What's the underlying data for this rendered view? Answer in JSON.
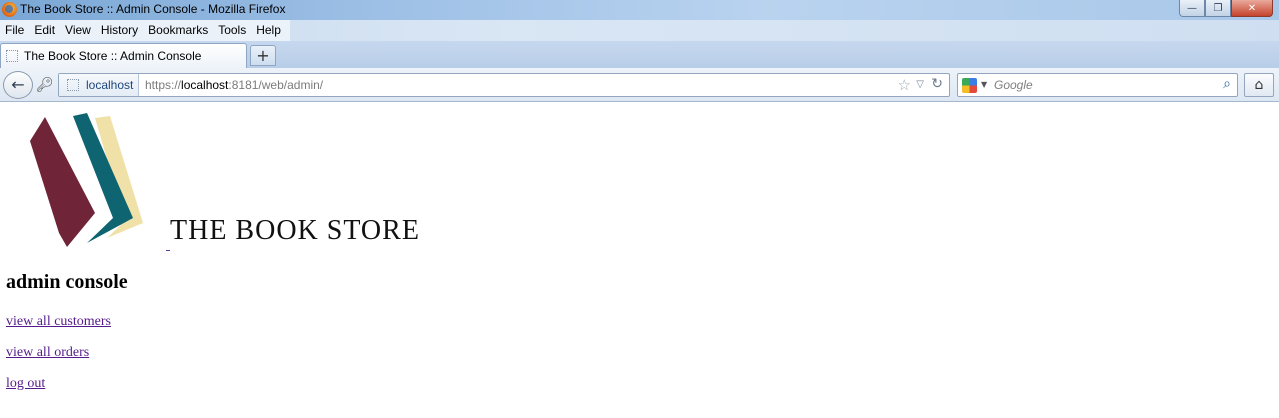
{
  "window": {
    "title": "The Book Store :: Admin Console - Mozilla Firefox",
    "buttons": {
      "minimize": "—",
      "maximize": "❐",
      "close": "✕"
    }
  },
  "menubar": {
    "items": [
      "File",
      "Edit",
      "View",
      "History",
      "Bookmarks",
      "Tools",
      "Help"
    ]
  },
  "tabs": {
    "active_label": "The Book Store :: Admin Console",
    "new_tab_label": "+"
  },
  "navbar": {
    "identity": "localhost",
    "url_prefix": "https://",
    "url_host": "localhost",
    "url_rest": ":8181/web/admin/",
    "search_placeholder": "Google",
    "icons": {
      "back": "back-arrow-icon",
      "key": "key-icon",
      "star": "star-icon",
      "reload": "reload-icon",
      "search": "magnifier-icon",
      "home": "home-icon"
    }
  },
  "page": {
    "logo_text": "THE BOOK STORE",
    "heading": "admin console",
    "links": [
      "view all customers",
      "view all orders",
      "log out"
    ],
    "colors": {
      "logo_maroon": "#6f2438",
      "logo_teal": "#0e6470",
      "logo_cream": "#efe1a8",
      "visited_link": "#551a8b"
    }
  }
}
